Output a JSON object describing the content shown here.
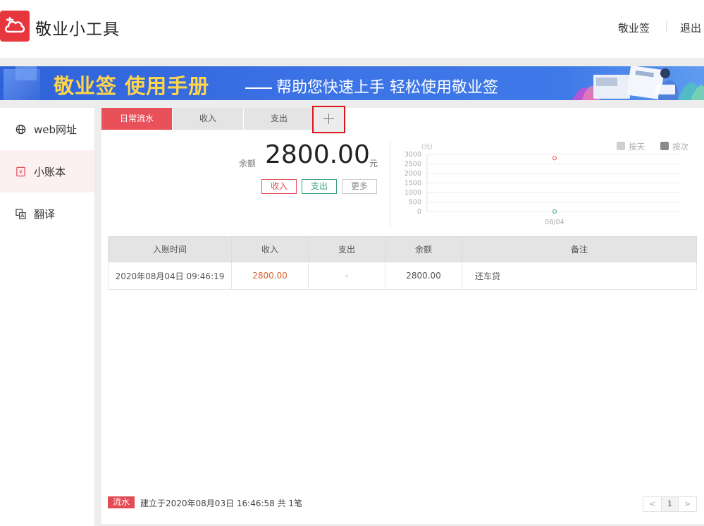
{
  "header": {
    "app_title": "敬业小工具",
    "links": [
      "敬业签",
      "退出"
    ]
  },
  "banner": {
    "main": "敬业签 使用手册",
    "sub": "帮助您快速上手  轻松使用敬业签"
  },
  "sidebar": {
    "items": [
      {
        "label": "web网址",
        "icon": "globe-icon"
      },
      {
        "label": "小账本",
        "icon": "ledger-icon",
        "active": true
      },
      {
        "label": "翻译",
        "icon": "translate-icon"
      }
    ]
  },
  "tabs": [
    "日常流水",
    "收入",
    "支出"
  ],
  "balance": {
    "label": "余额",
    "value": "2800.00",
    "unit": "元"
  },
  "actions": {
    "income": "收入",
    "expense": "支出",
    "more": "更多"
  },
  "chart_data": {
    "type": "scatter",
    "unit_label": "(元)",
    "y_ticks": [
      "3000",
      "2500",
      "2000",
      "1500",
      "1000",
      "500",
      "0"
    ],
    "ylim": [
      0,
      3000
    ],
    "x_ticks": [
      "08/04"
    ],
    "legend": [
      "按天",
      "按次"
    ],
    "legend_placement": "top-right",
    "grid": true,
    "series": [
      {
        "color": "#e34c55",
        "points": [
          {
            "x": "08/04",
            "y": 2800
          }
        ]
      },
      {
        "color": "#3aa07a",
        "points": [
          {
            "x": "08/04",
            "y": 0
          }
        ]
      }
    ]
  },
  "table": {
    "headers": [
      "入账时间",
      "收入",
      "支出",
      "余额",
      "备注"
    ],
    "rows": [
      [
        "2020年08月04日 09:46:19",
        "2800.00",
        "-",
        "2800.00",
        "还车贷"
      ]
    ]
  },
  "footer": {
    "badge": "流水",
    "text": "建立于2020年08月03日 16:46:58  共 1笔",
    "pager": {
      "prev": "<",
      "page": "1",
      "next": ">"
    }
  },
  "colors": {
    "accent": "#e34c55",
    "income": "#d9622b",
    "expense": "#3aa07a",
    "highlight_border": "#d9161c"
  }
}
